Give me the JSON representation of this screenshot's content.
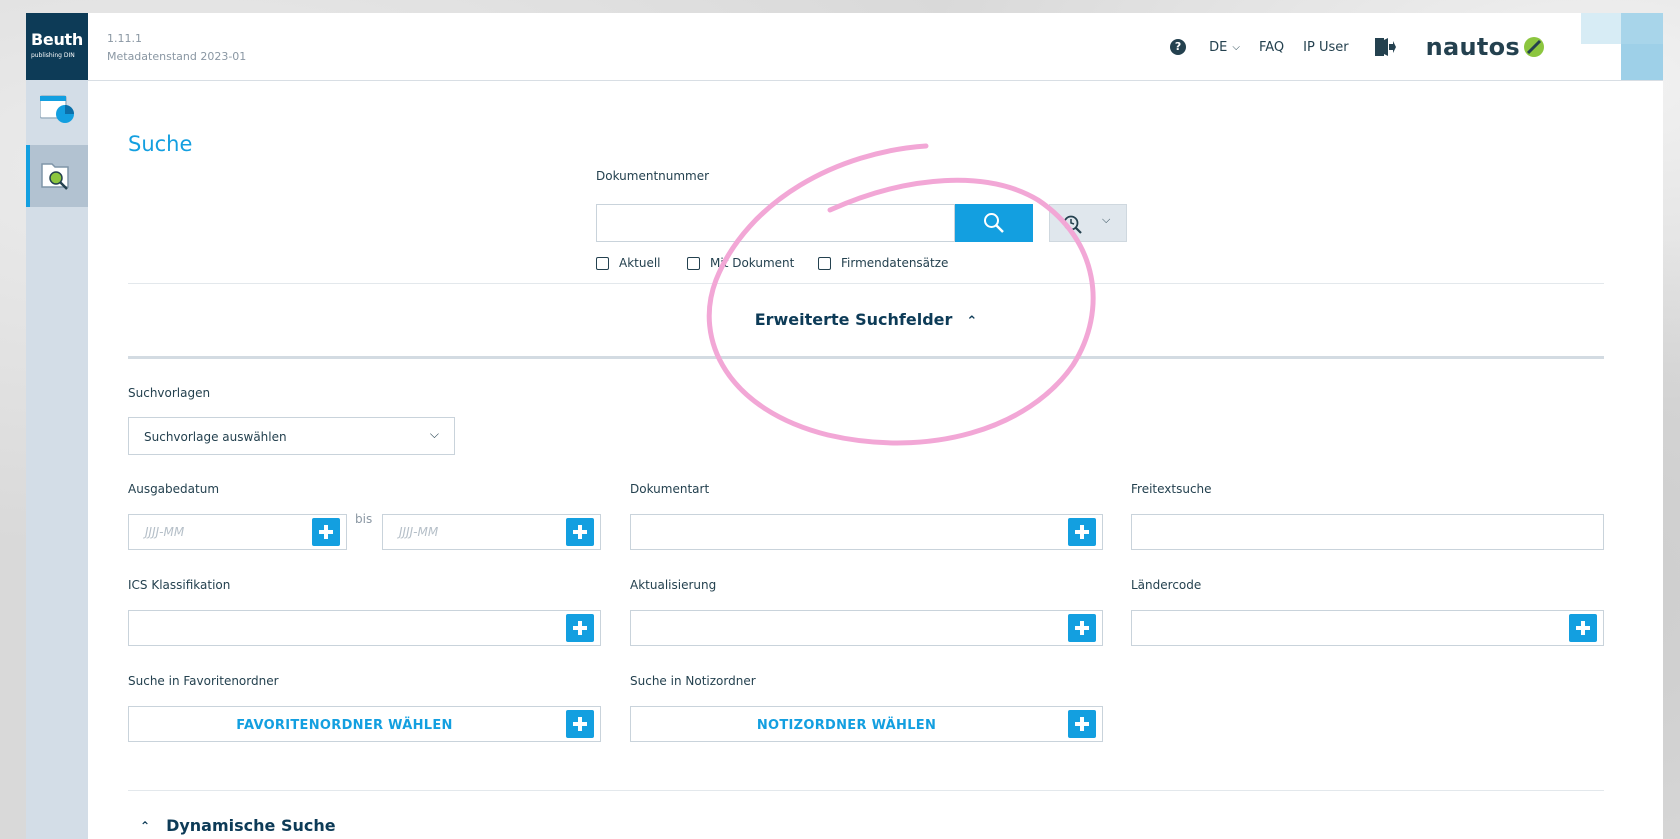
{
  "sidebar": {
    "brand_name": "Beuth",
    "brand_sub": "publishing DIN",
    "items": [
      {
        "icon": "dashboard-icon"
      },
      {
        "icon": "search-document-icon"
      }
    ]
  },
  "header": {
    "version": "1.11.1",
    "metadata": "Metadatenstand 2023-01",
    "language": "DE",
    "faq": "FAQ",
    "user": "IP User",
    "logo": "nautos"
  },
  "search": {
    "title": "Suche",
    "doc_number_label": "Dokumentnummer",
    "doc_number_value": "",
    "checkboxes": [
      {
        "label": "Aktuell",
        "checked": false
      },
      {
        "label": "Mit Dokument",
        "checked": false
      },
      {
        "label": "Firmendatensätze",
        "checked": false
      }
    ],
    "advanced_toggle": "Erweiterte Suchfelder"
  },
  "advanced": {
    "templates_label": "Suchvorlagen",
    "templates_selected": "Suchvorlage auswählen",
    "issue_date_label": "Ausgabedatum",
    "date_from_placeholder": "JJJJ-MM",
    "date_to_placeholder": "JJJJ-MM",
    "bis": "bis",
    "doc_type_label": "Dokumentart",
    "freetext_label": "Freitextsuche",
    "ics_label": "ICS Klassifikation",
    "update_label": "Aktualisierung",
    "country_label": "Ländercode",
    "fav_folder_label": "Suche in Favoritenordner",
    "fav_folder_button": "FAVORITENORDNER WÄHLEN",
    "note_folder_label": "Suche in Notizordner",
    "note_folder_button": "NOTIZORDNER WÄHLEN"
  },
  "dynamic": {
    "label": "Dynamische Suche"
  },
  "colors": {
    "accent": "#139fe0",
    "navy": "#0d3b57",
    "annotation": "#f2a7d6"
  }
}
